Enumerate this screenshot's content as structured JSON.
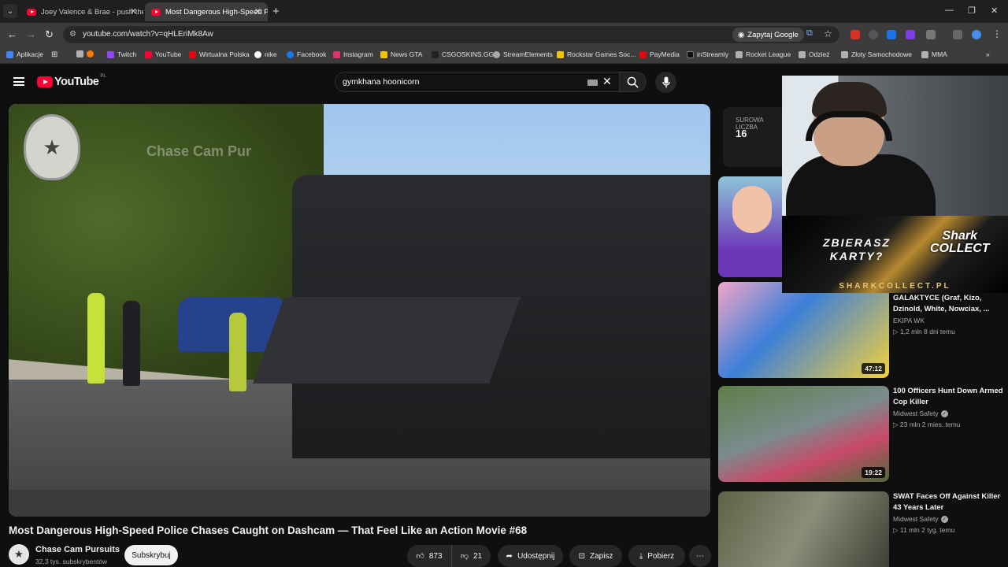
{
  "browser": {
    "tabs": [
      {
        "label": "Joey Valence & Brae - push the",
        "active": false
      },
      {
        "label": "Most Dangerous High-Speed Pol",
        "active": true
      }
    ],
    "url": "youtube.com/watch?v=qHLEriMk8Aw",
    "google_button": "Zapytaj Google",
    "bookmarks": [
      {
        "label": "Aplikacje",
        "icon": "apps-icon",
        "color": "#4285f4"
      },
      {
        "label": "",
        "icon": "folder-icon",
        "color": "#b0b0b0"
      },
      {
        "label": "Twitch",
        "icon": "twitch-icon",
        "color": "#9146ff"
      },
      {
        "label": "YouTube",
        "icon": "youtube-icon",
        "color": "#ff0033"
      },
      {
        "label": "Wirtualna Polska",
        "icon": "wp-icon",
        "color": "#e30613"
      },
      {
        "label": "nike",
        "icon": "nike-icon",
        "color": "#ffffff"
      },
      {
        "label": "Facebook",
        "icon": "facebook-icon",
        "color": "#1877f2"
      },
      {
        "label": "Instagram",
        "icon": "instagram-icon",
        "color": "#e1306c"
      },
      {
        "label": "News GTA",
        "icon": "newsgta-icon",
        "color": "#f5c400"
      },
      {
        "label": "CSGOSKINS.GG",
        "icon": "csgoskins-icon",
        "color": "#222222"
      },
      {
        "label": "StreamElements",
        "icon": "streamelements-icon",
        "color": "#aaaaaa"
      },
      {
        "label": "Rockstar Games Soc...",
        "icon": "rockstar-icon",
        "color": "#f5c400"
      },
      {
        "label": "PayMedia",
        "icon": "paymedia-icon",
        "color": "#e30613"
      },
      {
        "label": "inStreamly",
        "icon": "instreamly-icon",
        "color": "#111111"
      },
      {
        "label": "Rocket League",
        "icon": "folder-icon",
        "color": "#b0b0b0"
      },
      {
        "label": "Odzież",
        "icon": "folder-icon",
        "color": "#b0b0b0"
      },
      {
        "label": "Złoty Samochodowe",
        "icon": "folder-icon",
        "color": "#b0b0b0"
      },
      {
        "label": "MMA",
        "icon": "folder-icon",
        "color": "#b0b0b0"
      }
    ]
  },
  "youtube": {
    "logo_text": "YouTube",
    "country": "PL",
    "search_value": "gymkhana hoonicorn",
    "video": {
      "watermark": "Chase Cam Pur",
      "title": "Most Dangerous High-Speed Police Chases Caught on Dashcam — That Feel Like an Action Movie #68",
      "channel": "Chase Cam Pursuits",
      "subscribers": "32,3 tys. subskrybentów",
      "subscribe_label": "Subskrybuj",
      "likes": "873",
      "dislikes": "21",
      "share_label": "Udostępnij",
      "save_label": "Zapisz",
      "download_label": "Pobierz"
    },
    "chip": {
      "label": "SUROWA LICZBA",
      "value": "16"
    },
    "recommendations": [
      {
        "title": "GALAKTYCE (Graf, Kizo, Dzinold, White, Nowciax, ...",
        "channel": "EKIPA WK",
        "verified": false,
        "meta": "1,2 mln  8 dni temu",
        "duration": "47:12"
      },
      {
        "title": "100 Officers Hunt Down Armed Cop Killer",
        "channel": "Midwest Safety",
        "verified": true,
        "meta": "23 mln  2 mies. temu",
        "duration": "19:22"
      },
      {
        "title": "SWAT Faces Off Against Killer 43 Years Later",
        "channel": "Midwest Safety",
        "verified": true,
        "meta": "11 mln  2 tyg. temu",
        "duration": ""
      }
    ]
  },
  "overlay": {
    "ad_question": "ZBIERASZ KARTY?",
    "ad_brand_top": "Shark",
    "ad_brand_bottom": "COLLECT",
    "ad_url": "SHARKCOLLECT.PL"
  }
}
